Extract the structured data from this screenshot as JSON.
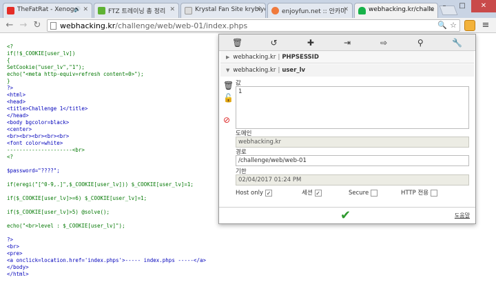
{
  "browser": {
    "tabs": [
      {
        "title": "TheFatRat - Xenoge",
        "favicon_color": "#e52d27",
        "active": false,
        "audio": true
      },
      {
        "title": "FTZ 트레이닝 총 정리",
        "favicon_color": "#5fb234",
        "active": false,
        "audio": false
      },
      {
        "title": "Krystal Fan Site krybiye",
        "favicon_color": "#dcdcdc",
        "active": false,
        "audio": false
      },
      {
        "title": "enjoyfun.net :: 안카미",
        "favicon_color": "#f07a3c",
        "active": false,
        "audio": false
      },
      {
        "title": "webhacking.kr/challe",
        "favicon_color": "#17b24a",
        "active": true,
        "audio": false
      }
    ],
    "window_buttons": {
      "minimize": "–",
      "maximize": "□",
      "close": "✕"
    },
    "url_host": "webhacking.kr",
    "url_path": "/challenge/web/web-01/index.phps"
  },
  "source_code": {
    "lines": [
      "<?",
      "if(!$_COOKIE[user_lv])",
      "{",
      "SetCookie(\"user_lv\",\"1\");",
      "echo(\"<meta http-equiv=refresh content=0>\");",
      "}",
      "?>",
      "<html>",
      "<head>",
      "<title>Challenge 1</title>",
      "</head>",
      "<body bgcolor=black>",
      "<center>",
      "<br><br><br><br><br>",
      "<font color=white>",
      "---------------------<br>",
      "<?",
      "",
      "$password=\"????\";",
      "",
      "if(eregi(\"[^0-9,.]\",$_COOKIE[user_lv])) $_COOKIE[user_lv]=1;",
      "",
      "if($_COOKIE[user_lv]>=6) $_COOKIE[user_lv]=1;",
      "",
      "if($_COOKIE[user_lv]>5) @solve();",
      "",
      "echo(\"<br>level : $_COOKIE[user_lv]\");",
      "",
      "?>",
      "<br>",
      "<pre>",
      "<a onclick=location.href='index.phps'>----- index.phps -----</a>",
      "</body>",
      "</html>"
    ]
  },
  "cookie_editor": {
    "toolbar_icons": [
      "trash-icon",
      "undo-icon",
      "add-icon",
      "import-icon",
      "export-icon",
      "search-icon",
      "settings-icon"
    ],
    "cookies": [
      {
        "domain": "webhacking.kr",
        "name": "PHPSESSID",
        "expanded": false
      },
      {
        "domain": "webhacking.kr",
        "name": "user_lv",
        "expanded": true
      }
    ],
    "value_label": "값",
    "value": "1",
    "domain_label": "도메인",
    "domain_value": "webhacking.kr",
    "path_label": "경로",
    "path_value": "/challenge/web/web-01",
    "expires_label": "기한",
    "expires_value": "02/04/2017 01:24 PM",
    "checks": [
      {
        "label": "Host only",
        "checked": true
      },
      {
        "label": "세션",
        "checked": true
      },
      {
        "label": "Secure",
        "checked": false
      },
      {
        "label": "HTTP 전용",
        "checked": false
      }
    ],
    "help_label": "도움말",
    "accent": "#2f9a2f"
  }
}
